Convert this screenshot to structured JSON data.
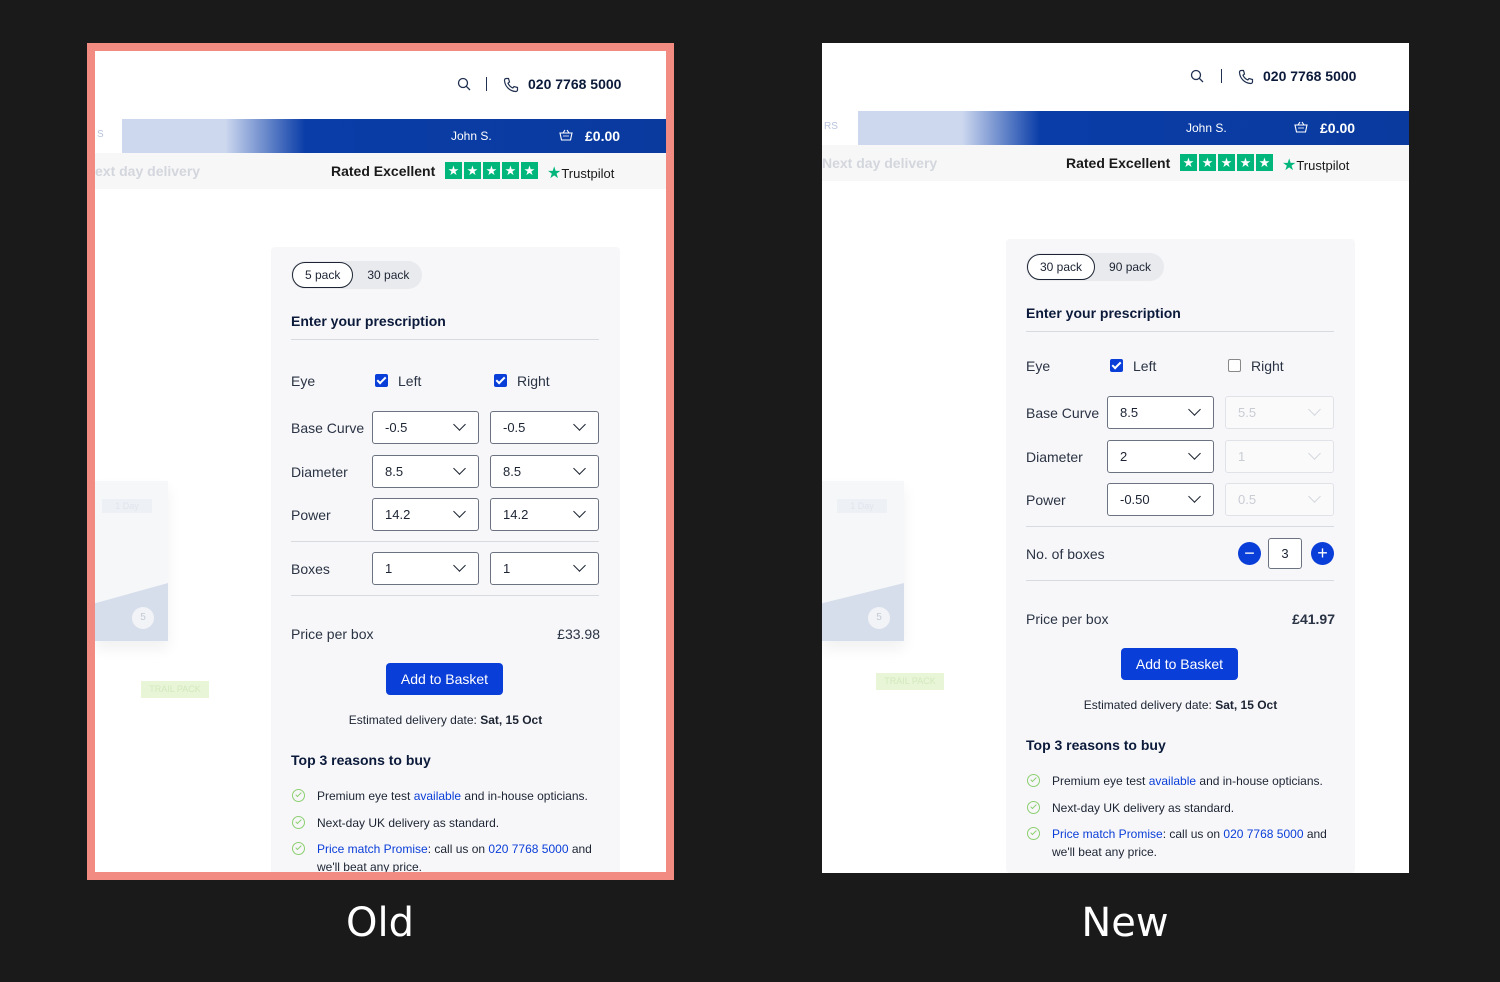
{
  "captions": {
    "old": "Old",
    "new": "New"
  },
  "header": {
    "phone": "020 7768 5000",
    "user": "John S.",
    "basket_total": "£0.00",
    "next_day": "Next day delivery",
    "next_day_cut": "ext day delivery",
    "rated": "Rated Excellent",
    "trustpilot": "Trustpilot",
    "left_tag_old": "S",
    "left_tag_new": "RS"
  },
  "product_image": {
    "day_label": "1 Day",
    "circle": "5",
    "trail": "TRAIL PACK"
  },
  "old": {
    "packs": [
      "5 pack",
      "30 pack"
    ],
    "heading": "Enter your prescription",
    "eye_label": "Eye",
    "left_label": "Left",
    "right_label": "Right",
    "rows": [
      {
        "label": "Base Curve",
        "left": "-0.5",
        "right": "-0.5"
      },
      {
        "label": "Diameter",
        "left": "8.5",
        "right": "8.5"
      },
      {
        "label": "Power",
        "left": "14.2",
        "right": "14.2"
      }
    ],
    "boxes_label": "Boxes",
    "boxes_left": "1",
    "boxes_right": "1",
    "price_label": "Price per box",
    "price": "£33.98",
    "button": "Add to Basket",
    "est_prefix": "Estimated delivery date:",
    "est_date": "Sat, 15 Oct",
    "reasons_heading": "Top 3 reasons to buy"
  },
  "new": {
    "packs": [
      "30 pack",
      "90 pack"
    ],
    "heading": "Enter your prescription",
    "eye_label": "Eye",
    "left_label": "Left",
    "right_label": "Right",
    "rows": [
      {
        "label": "Base Curve",
        "left": "8.5",
        "right": "5.5"
      },
      {
        "label": "Diameter",
        "left": "2",
        "right": "1"
      },
      {
        "label": "Power",
        "left": "-0.50",
        "right": "0.5"
      }
    ],
    "boxes_label": "No. of boxes",
    "boxes_value": "3",
    "price_label": "Price per box",
    "price": "£41.97",
    "button": "Add to Basket",
    "est_prefix": "Estimated delivery date:",
    "est_date": "Sat, 15 Oct",
    "reasons_heading": "Top 3 reasons to buy"
  },
  "reasons": {
    "r1_pre": "Premium eye test ",
    "r1_link": "available",
    "r1_post": " and in-house opticians.",
    "r2": "Next-day UK delivery as standard.",
    "r3_link": "Price match Promise",
    "r3_mid": ": call us on ",
    "r3_phone": "020 7768 5000",
    "r3_post": " and we'll beat any price."
  },
  "colors": {
    "brand_blue": "#0a3ed8",
    "navy_bar": "#0a3a9e",
    "trustpilot_green": "#00b67a",
    "old_frame": "#f28b82"
  }
}
